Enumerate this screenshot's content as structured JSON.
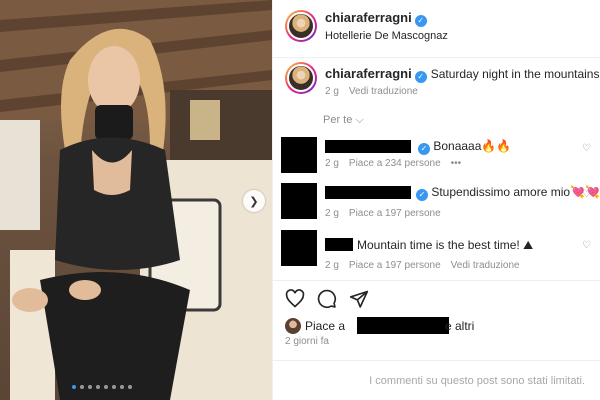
{
  "post": {
    "username": "chiaraferragni",
    "location": "Hotellerie De Mascognaz",
    "photo_dots": 8,
    "photo_active_dot": 0
  },
  "caption": {
    "username": "chiaraferragni",
    "text": "Saturday night in the mountains ⛰",
    "age": "2 g",
    "translate": "Vedi traduzione"
  },
  "comments_header": "Per te ⌵",
  "comments": [
    {
      "text": "Bonaaaa🔥🔥",
      "age": "2 g",
      "likes": "Piace a 234 persone",
      "more": "•••"
    },
    {
      "text": "Stupendissimo amore mio💘💘💘",
      "age": "2 g",
      "likes": "Piace a 197 persone"
    },
    {
      "text": "Mountain time is the best time! ⛰",
      "age": "2 g",
      "likes": "Piace a 197 persone",
      "translate": "Vedi traduzione"
    }
  ],
  "likes": {
    "prefix": "Piace a",
    "suffix": "e altri"
  },
  "time_ago": "2 giorni fa",
  "comments_limited": "I commenti su questo post sono stati limitati.",
  "icons": [
    "heart-icon",
    "comment-icon",
    "share-icon",
    "verified-icon",
    "chevron-right-icon"
  ],
  "colors": {
    "verified": "#3897f0",
    "meta": "#8e8e8e",
    "border": "#efefef"
  }
}
